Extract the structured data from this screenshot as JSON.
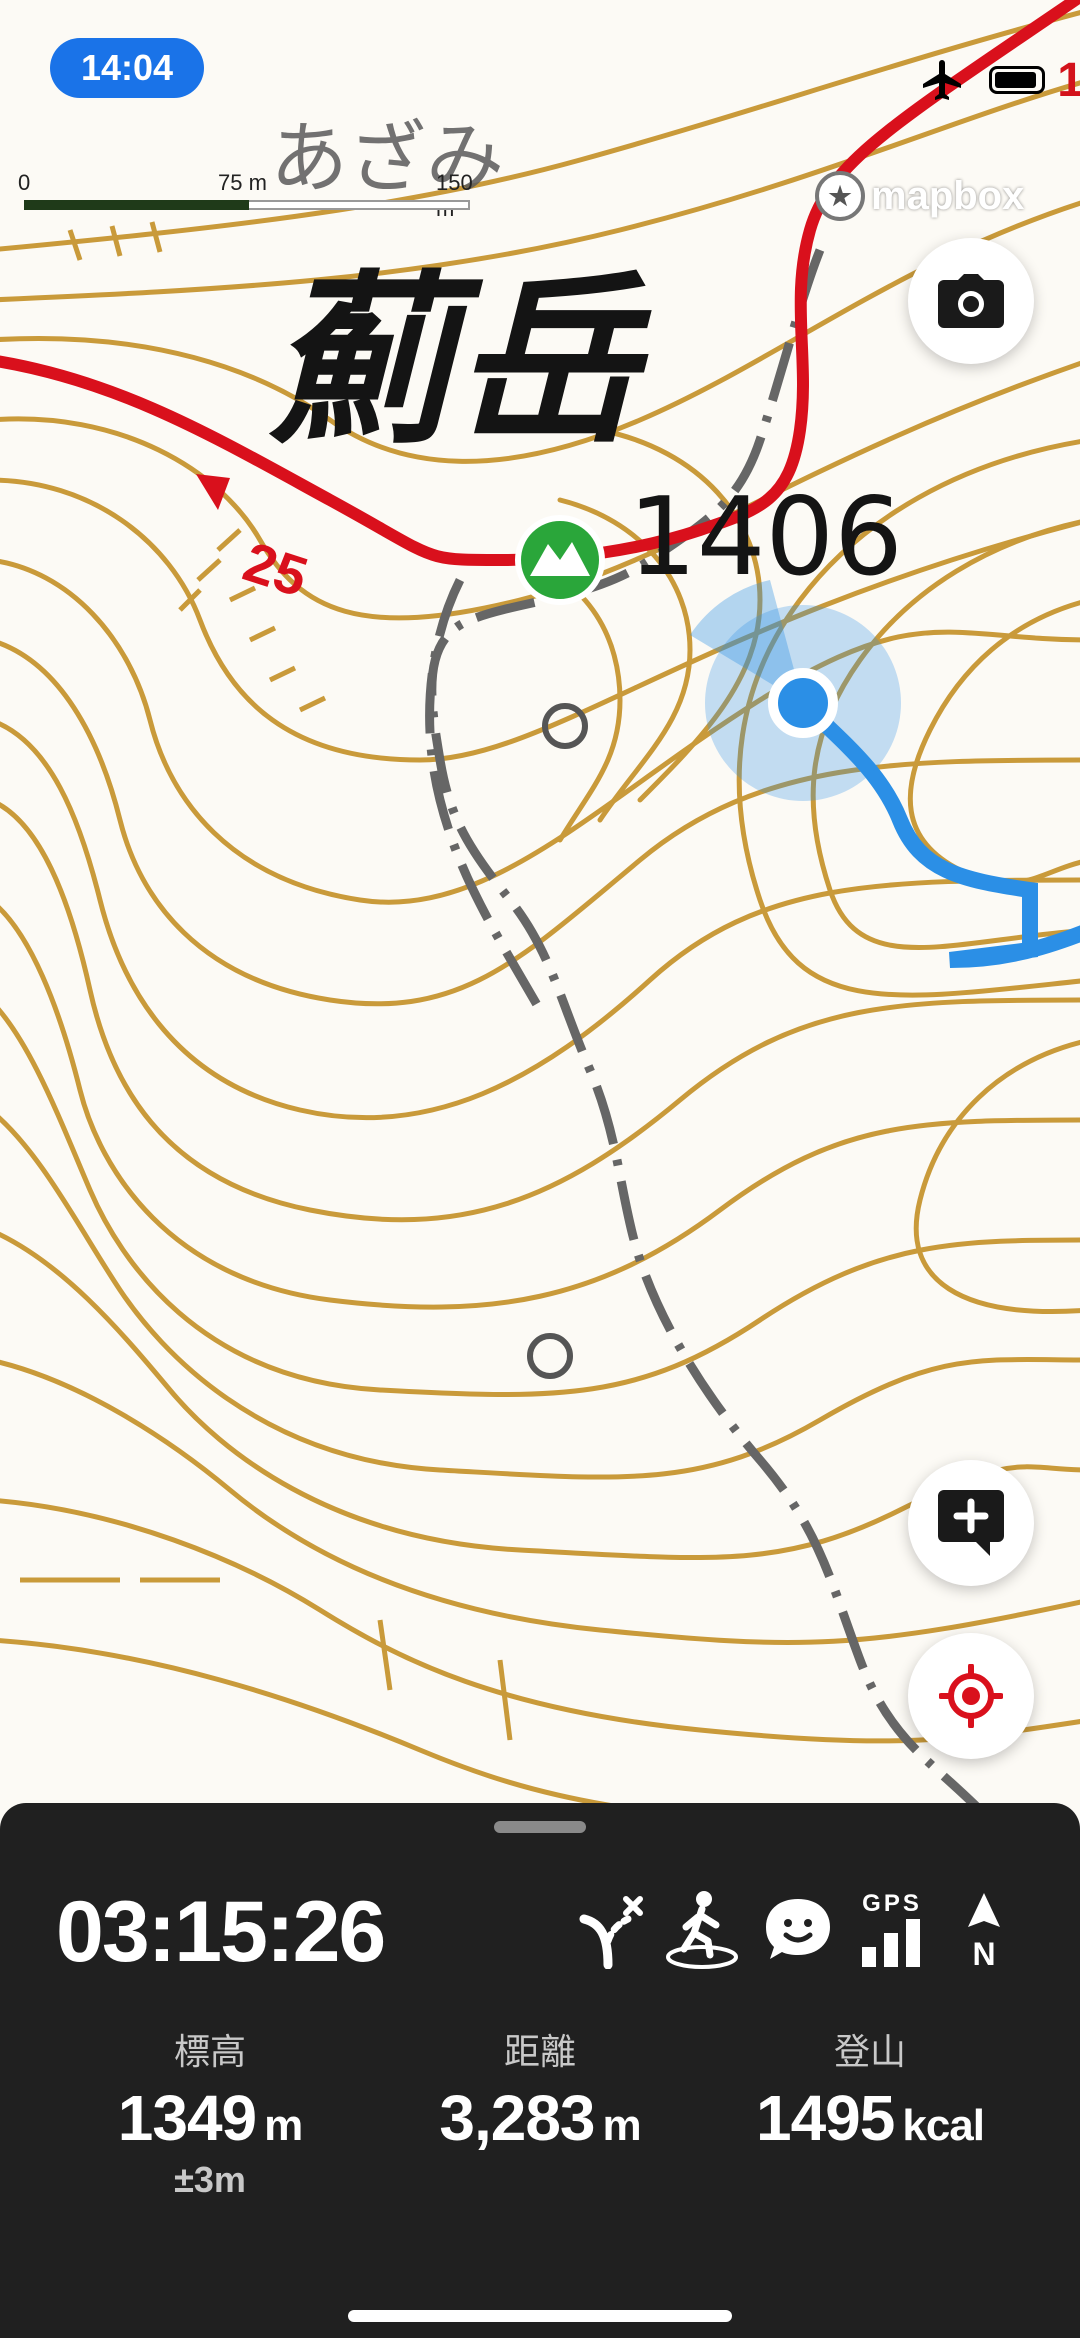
{
  "status_bar": {
    "time": "14:04",
    "right_text": "1"
  },
  "map": {
    "scale": {
      "zero": "0",
      "mid": "75 m",
      "max": "150 m"
    },
    "place_reading": "あざみ",
    "place_name": "薊岳",
    "elevation_label": "1406",
    "route_number": "25",
    "attribution": "mapbox",
    "colors": {
      "route_red": "#d9101c",
      "track_blue": "#2b8fe6",
      "contour": "#c99a3a",
      "trail_gray": "#666666",
      "peak_green": "#2aa63a"
    }
  },
  "buttons": {
    "camera": "camera-icon",
    "add_comment": "add-comment-icon",
    "locate": "locate-icon"
  },
  "panel": {
    "elapsed": "03:15:26",
    "status_icons": [
      "route-split-icon",
      "hiker-icon",
      "chat-face-icon",
      "gps-signal-icon",
      "north-icon"
    ],
    "gps_text": "GPS",
    "north_text": "N",
    "stats": [
      {
        "label": "標高",
        "value": "1349",
        "unit": "m",
        "sub": "±3m"
      },
      {
        "label": "距離",
        "value": "3,283",
        "unit": "m"
      },
      {
        "label": "登山",
        "value": "1495",
        "unit": "kcal"
      }
    ]
  }
}
